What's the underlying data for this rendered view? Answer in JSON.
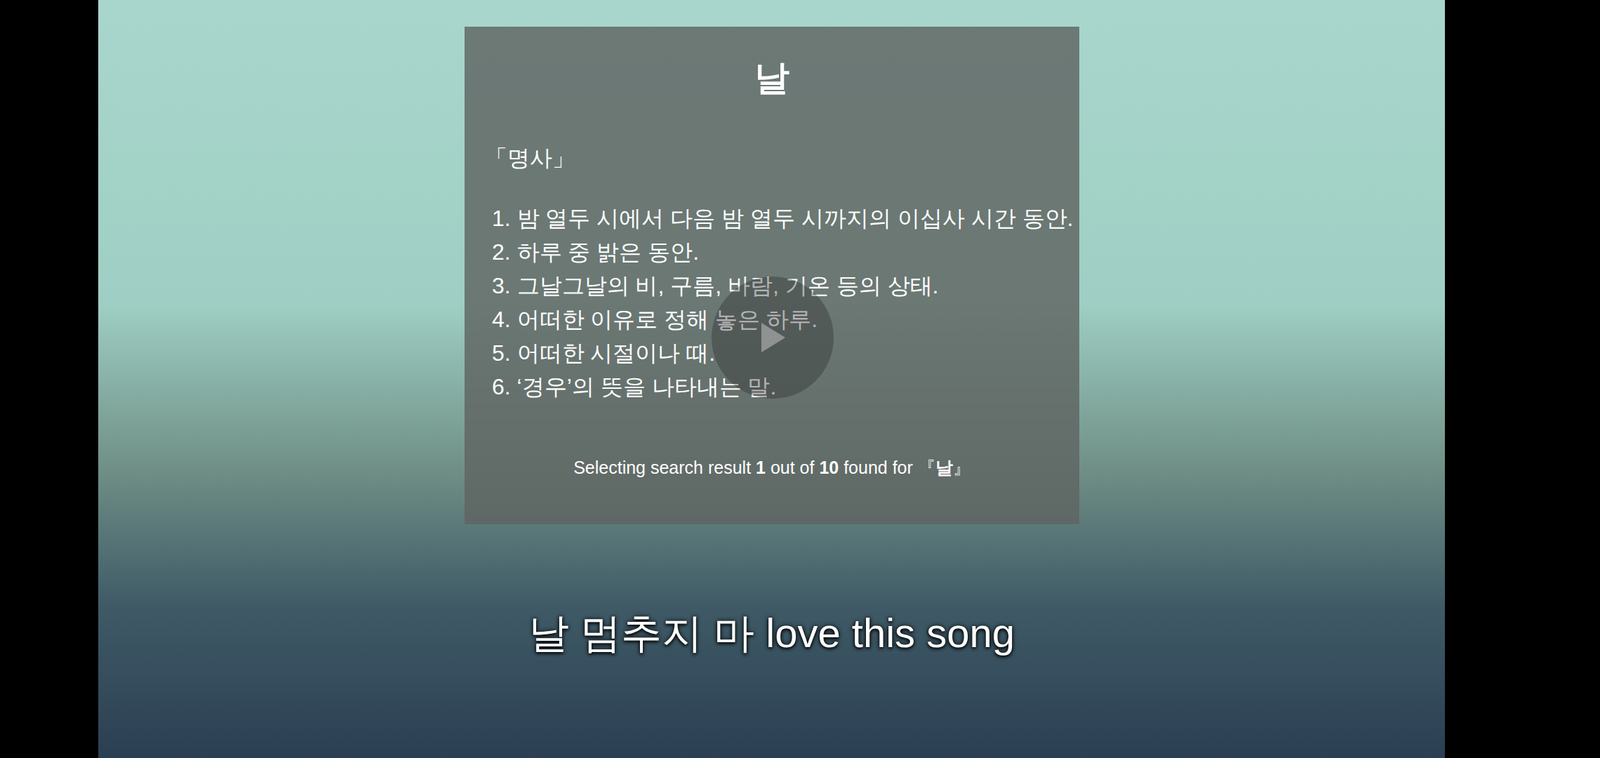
{
  "dictionary": {
    "headword": "날",
    "part_of_speech": "「명사」",
    "definitions": [
      "1. 밤 열두 시에서 다음 밤 열두 시까지의 이십사 시간 동안.",
      "2. 하루 중 밝은 동안.",
      "3. 그날그날의 비, 구름, 바람, 기온 등의 상태.",
      "4. 어떠한 이유로 정해 놓은 하루.",
      "5. 어떠한 시절이나 때.",
      "6. ‘경우’의 뜻을 나타내는 말."
    ],
    "footer": {
      "prefix": "Selecting search result",
      "index": "1",
      "middle": "out of",
      "total": "10",
      "suffix": "found for",
      "open_bracket": "『",
      "query": "날",
      "close_bracket": "』"
    }
  },
  "subtitle": "날 멈추지 마 love this song"
}
